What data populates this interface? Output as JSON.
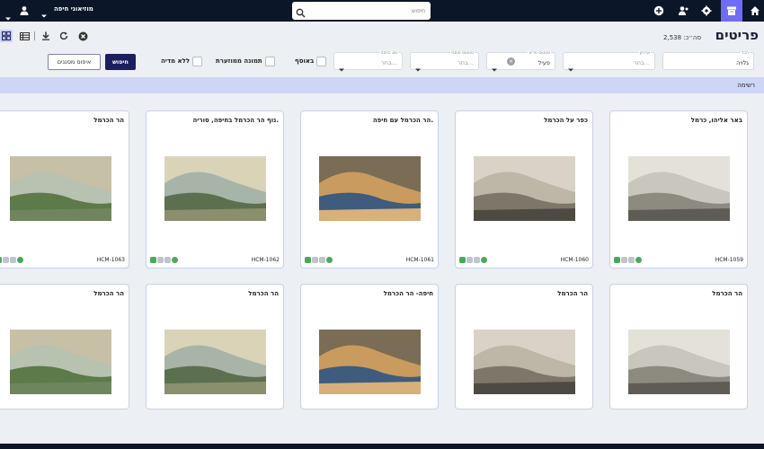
{
  "topbar": {
    "search_placeholder": "חיפוש",
    "org_name": "מוזיאוני חיפה"
  },
  "header": {
    "title": "פריטים",
    "total_label": "סה״כ: 2,538"
  },
  "filters": {
    "collection": {
      "label": "הכל",
      "value": "גלויה"
    },
    "archive": {
      "label": "ארכיון",
      "value": "בחר..."
    },
    "item_status": {
      "label": "סטטוס פריט",
      "value": "פעיל"
    },
    "public_status": {
      "label": "סטטוס פומבי",
      "value": "בחר..."
    },
    "entry_type": {
      "label": "סוג כניסה",
      "value": "בחר..."
    },
    "checkbox_in_collection": "באוסף",
    "checkbox_featured_image": "תמונה ממוזערת",
    "checkbox_no_media": "ללא מדיה",
    "search_button": "חיפוש",
    "reset_button": "איפוס מסננים"
  },
  "list_bar": "רשימה",
  "cards": [
    {
      "title": "באר אליהו, כרמל",
      "id": "HCM-1059"
    },
    {
      "title": "כפר על הכרמל",
      "id": "HCM-1060"
    },
    {
      "title": "הר הכרמל עם חיפה.",
      "id": "HCM-1061"
    },
    {
      "title": "נוף הר הכרמל בחיפה, סוריה.",
      "id": "HCM-1062"
    },
    {
      "title": "הר הכרמל",
      "id": "HCM-1063"
    },
    {
      "title": "הר הכרמל",
      "id": ""
    },
    {
      "title": "הר הכרמל",
      "id": ""
    },
    {
      "title": "חיפה- הר הכרמל",
      "id": ""
    },
    {
      "title": "הר הכרמל",
      "id": ""
    },
    {
      "title": "הר הכרמל",
      "id": ""
    }
  ]
}
